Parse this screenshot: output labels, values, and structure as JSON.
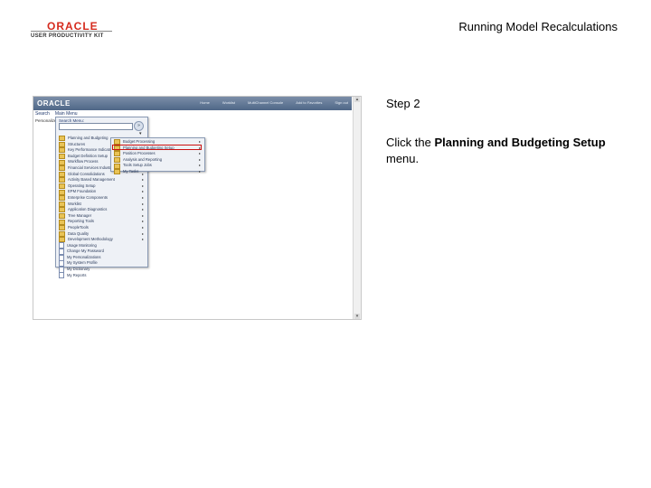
{
  "header": {
    "logo_brand": "ORACLE",
    "logo_sub": "USER PRODUCTIVITY KIT",
    "document_title": "Running Model Recalculations"
  },
  "screenshot": {
    "app_logo": "ORACLE",
    "nav_links": [
      "Home",
      "Worklist",
      "MultiChannel Console",
      "Add to Favorites",
      "Sign out"
    ],
    "toolbar": [
      "Search",
      "Main Menu"
    ],
    "recent": "Personalize",
    "search_menu_label": "Search Menu:",
    "main_menu_items": [
      {
        "label": "Planning and Budgeting",
        "icon": "folder-icon",
        "arrow": "▸"
      },
      {
        "label": "Structures",
        "icon": "folder-icon",
        "arrow": "▸"
      },
      {
        "label": "Key Performance Indicators",
        "icon": "folder-icon",
        "arrow": "▸"
      },
      {
        "label": "Budget Definition Setup",
        "icon": "folder-icon",
        "arrow": "▸"
      },
      {
        "label": "Workflow Process",
        "icon": "folder-icon",
        "arrow": "▸"
      },
      {
        "label": "Financial Services Industries",
        "icon": "folder-icon",
        "arrow": "▸"
      },
      {
        "label": "Global Consolidations",
        "icon": "folder-icon",
        "arrow": "▸"
      },
      {
        "label": "Activity Based Management",
        "icon": "folder-icon",
        "arrow": "▸"
      },
      {
        "label": "Operating Setup",
        "icon": "folder-icon",
        "arrow": "▸"
      },
      {
        "label": "EPM Foundation",
        "icon": "folder-icon",
        "arrow": "▸"
      },
      {
        "label": "Enterprise Components",
        "icon": "folder-icon",
        "arrow": "▸"
      },
      {
        "label": "Worklist",
        "icon": "folder-icon",
        "arrow": "▸"
      },
      {
        "label": "Application Diagnostics",
        "icon": "folder-icon",
        "arrow": "▸"
      },
      {
        "label": "Tree Manager",
        "icon": "folder-icon",
        "arrow": "▸"
      },
      {
        "label": "Reporting Tools",
        "icon": "folder-icon",
        "arrow": "▸"
      },
      {
        "label": "PeopleTools",
        "icon": "folder-icon",
        "arrow": "▸"
      },
      {
        "label": "Data Quality",
        "icon": "folder-icon",
        "arrow": "▸"
      },
      {
        "label": "Development Methodology",
        "icon": "folder-icon",
        "arrow": "▸"
      },
      {
        "label": "Usage Monitoring",
        "icon": "doc-icon",
        "arrow": ""
      },
      {
        "label": "Change My Password",
        "icon": "doc-icon",
        "arrow": ""
      },
      {
        "label": "My Personalizations",
        "icon": "doc-icon",
        "arrow": ""
      },
      {
        "label": "My System Profile",
        "icon": "doc-icon",
        "arrow": ""
      },
      {
        "label": "My Dictionary",
        "icon": "doc-icon",
        "arrow": ""
      },
      {
        "label": "My Reports",
        "icon": "doc-icon",
        "arrow": ""
      }
    ],
    "submenu_items": [
      {
        "label": "Budget Processing",
        "icon": "folder-icon",
        "arrow": "▸"
      },
      {
        "label": "Planning and Budgeting Setup",
        "icon": "folder-icon",
        "arrow": "▸"
      },
      {
        "label": "Position Processes",
        "icon": "folder-icon",
        "arrow": "▸"
      },
      {
        "label": "Analysis and Reporting",
        "icon": "folder-icon",
        "arrow": "▸"
      },
      {
        "label": "Tools Setup Jobs",
        "icon": "folder-icon",
        "arrow": "▸"
      },
      {
        "label": "My Tasks",
        "icon": "folder-icon",
        "arrow": "▸"
      }
    ],
    "highlight_color": "#cc1111"
  },
  "instructions": {
    "step": "Step 2",
    "prefix": "Click the ",
    "target": "Planning and Budgeting Setup",
    "suffix": " menu."
  }
}
